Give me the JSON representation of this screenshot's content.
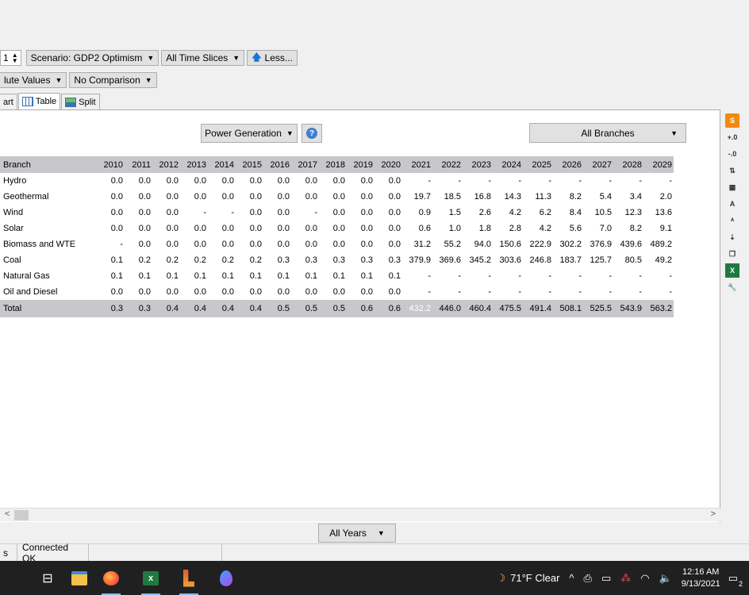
{
  "toolbar": {
    "year_value": "1",
    "scenario_label": "Scenario: GDP2 Optimism",
    "time_slices_label": "All Time Slices",
    "less_label": "Less...",
    "values_label": "lute Values",
    "comparison_label": "No Comparison"
  },
  "tabs": {
    "chart_label": "art",
    "table_label": "Table",
    "split_label": "Split"
  },
  "panel": {
    "variable_label": "Power Generation",
    "help_label": "?",
    "branches_label": "All Branches",
    "years_label": "All Years"
  },
  "table": {
    "header_branch": "Branch",
    "years": [
      "2010",
      "2011",
      "2012",
      "2013",
      "2014",
      "2015",
      "2016",
      "2017",
      "2018",
      "2019",
      "2020",
      "2021",
      "2022",
      "2023",
      "2024",
      "2025",
      "2026",
      "2027",
      "2028",
      "2029"
    ],
    "rows": [
      {
        "branch": "Hydro",
        "values": [
          "0.0",
          "0.0",
          "0.0",
          "0.0",
          "0.0",
          "0.0",
          "0.0",
          "0.0",
          "0.0",
          "0.0",
          "0.0",
          "-",
          "-",
          "-",
          "-",
          "-",
          "-",
          "-",
          "-",
          "-"
        ]
      },
      {
        "branch": "Geothermal",
        "values": [
          "0.0",
          "0.0",
          "0.0",
          "0.0",
          "0.0",
          "0.0",
          "0.0",
          "0.0",
          "0.0",
          "0.0",
          "0.0",
          "19.7",
          "18.5",
          "16.8",
          "14.3",
          "11.3",
          "8.2",
          "5.4",
          "3.4",
          "2.0"
        ]
      },
      {
        "branch": "Wind",
        "values": [
          "0.0",
          "0.0",
          "0.0",
          "-",
          "-",
          "0.0",
          "0.0",
          "-",
          "0.0",
          "0.0",
          "0.0",
          "0.9",
          "1.5",
          "2.6",
          "4.2",
          "6.2",
          "8.4",
          "10.5",
          "12.3",
          "13.6"
        ]
      },
      {
        "branch": "Solar",
        "values": [
          "0.0",
          "0.0",
          "0.0",
          "0.0",
          "0.0",
          "0.0",
          "0.0",
          "0.0",
          "0.0",
          "0.0",
          "0.0",
          "0.6",
          "1.0",
          "1.8",
          "2.8",
          "4.2",
          "5.6",
          "7.0",
          "8.2",
          "9.1"
        ]
      },
      {
        "branch": "Biomass and WTE",
        "values": [
          "-",
          "0.0",
          "0.0",
          "0.0",
          "0.0",
          "0.0",
          "0.0",
          "0.0",
          "0.0",
          "0.0",
          "0.0",
          "31.2",
          "55.2",
          "94.0",
          "150.6",
          "222.9",
          "302.2",
          "376.9",
          "439.6",
          "489.2"
        ]
      },
      {
        "branch": "Coal",
        "values": [
          "0.1",
          "0.2",
          "0.2",
          "0.2",
          "0.2",
          "0.2",
          "0.3",
          "0.3",
          "0.3",
          "0.3",
          "0.3",
          "379.9",
          "369.6",
          "345.2",
          "303.6",
          "246.8",
          "183.7",
          "125.7",
          "80.5",
          "49.2"
        ]
      },
      {
        "branch": "Natural Gas",
        "values": [
          "0.1",
          "0.1",
          "0.1",
          "0.1",
          "0.1",
          "0.1",
          "0.1",
          "0.1",
          "0.1",
          "0.1",
          "0.1",
          "-",
          "-",
          "-",
          "-",
          "-",
          "-",
          "-",
          "-",
          "-"
        ]
      },
      {
        "branch": "Oil and Diesel",
        "values": [
          "0.0",
          "0.0",
          "0.0",
          "0.0",
          "0.0",
          "0.0",
          "0.0",
          "0.0",
          "0.0",
          "0.0",
          "0.0",
          "-",
          "-",
          "-",
          "-",
          "-",
          "-",
          "-",
          "-",
          "-"
        ]
      }
    ],
    "total": {
      "branch": "Total",
      "values": [
        "0.3",
        "0.3",
        "0.4",
        "0.4",
        "0.4",
        "0.4",
        "0.5",
        "0.5",
        "0.5",
        "0.6",
        "0.6",
        "432.2",
        "446.0",
        "460.4",
        "475.5",
        "491.4",
        "508.1",
        "525.5",
        "543.9",
        "563.2"
      ]
    },
    "selected_cell": {
      "row": "total",
      "year": "2021"
    }
  },
  "status": {
    "left": "s",
    "connection": "Connected OK"
  },
  "taskbar": {
    "weather": "71°F  Clear",
    "time": "12:16 AM",
    "date": "9/13/2021",
    "notifications": "2"
  },
  "colors": {
    "header_bg": "#c8c8cc",
    "selection": "#1674d7",
    "taskbar_bg": "#202020"
  }
}
